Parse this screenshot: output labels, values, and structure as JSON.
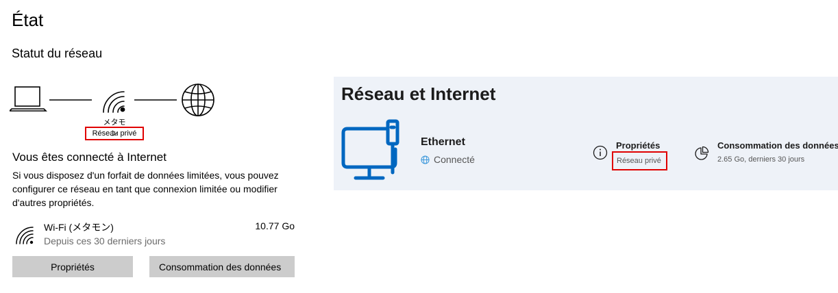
{
  "win10": {
    "title": "État",
    "section_title": "Statut du réseau",
    "network_name": "メタモン",
    "network_type": "Réseau privé",
    "connected_title": "Vous êtes connecté à Internet",
    "description": "Si vous disposez d'un forfait de données limitées, vous pouvez configurer ce réseau en tant que connexion limitée ou modifier d'autres propriétés.",
    "connection": {
      "name": "Wi-Fi (メタモン)",
      "subtitle": "Depuis ces 30 derniers jours",
      "usage": "10.77 Go"
    },
    "buttons": {
      "properties": "Propriétés",
      "data_usage": "Consommation des données"
    },
    "icons": [
      "laptop-icon",
      "wifi-icon",
      "globe-icon"
    ]
  },
  "win11": {
    "title": "Réseau et Internet",
    "adapter_name": "Ethernet",
    "status": "Connecté",
    "properties_label": "Propriétés",
    "properties_value": "Réseau privé",
    "usage_label": "Consommation des données",
    "usage_value": "2.65 Go, derniers 30 jours",
    "icons": [
      "ethernet-pc-icon",
      "globe-icon",
      "info-icon",
      "pie-chart-icon"
    ]
  },
  "colors": {
    "highlight_box": "#e00000",
    "button_bg": "#cccccc",
    "w11_panel_bg": "#eef2f8",
    "w11_accent": "#0067c0"
  }
}
